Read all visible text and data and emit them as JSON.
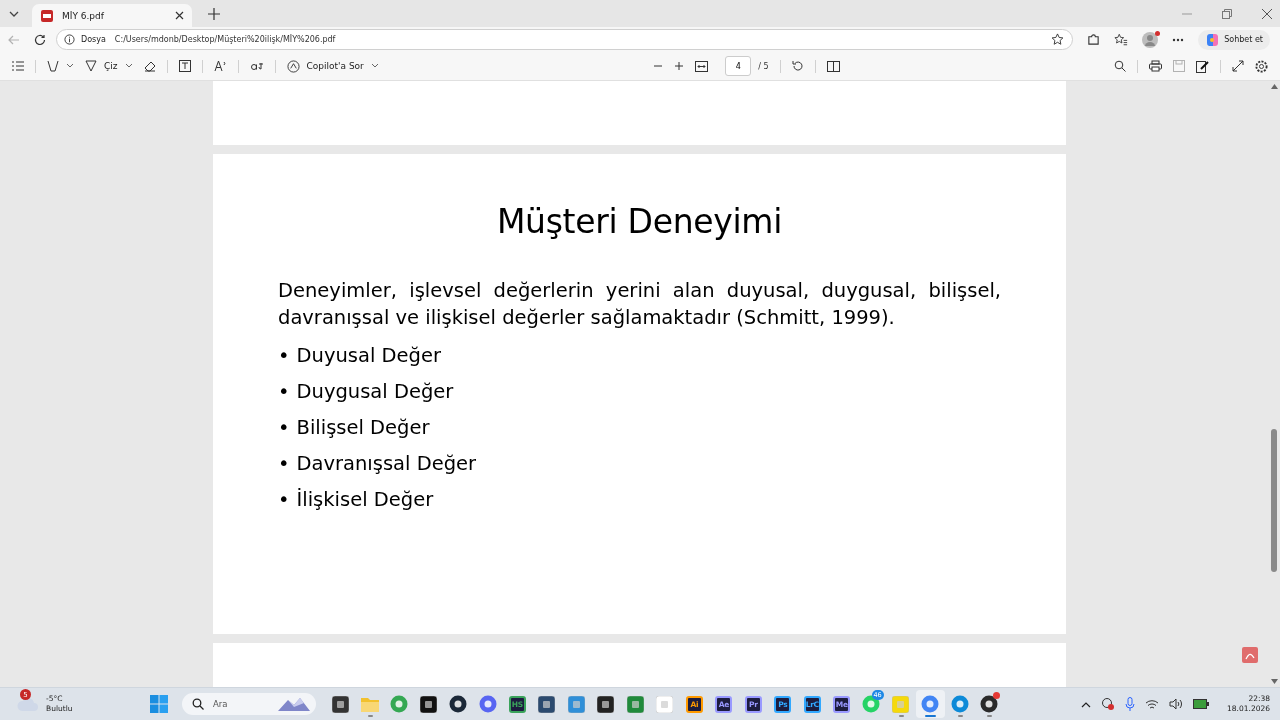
{
  "tabs": [
    {
      "title": "MİY 6.pdf",
      "selected": true
    }
  ],
  "address_bar": {
    "back_disabled": true,
    "scheme_label": "Dosya",
    "url": "C:/Users/mdonb/Desktop/Müşteri%20ilişk/MİY%206.pdf",
    "profile_alert": true,
    "copilot_label": "Sohbet et"
  },
  "pdf_toolbar": {
    "draw_label": "Çiz",
    "ask_label": "Copilot'a Sor",
    "page_value": "4",
    "page_total": "/ 5",
    "save_disabled": true
  },
  "page": {
    "title": "Müşteri Deneyimi",
    "paragraph": "Deneyimler, işlevsel değerlerin yerini alan duyusal, duygusal, bilişsel, davranışsal ve ilişkisel değerler sağlamaktadır (Schmitt, 1999).",
    "bullets": [
      {
        "bullet": "•",
        "text": "Duyusal Değer"
      },
      {
        "bullet": "•",
        "text": "Duygusal Değer"
      },
      {
        "bullet": "•",
        "text": "Bilişsel Değer"
      },
      {
        "bullet": "•",
        "text": "Davranışsal Değer"
      },
      {
        "bullet": "•",
        "text": "İlişkisel Değer"
      }
    ]
  },
  "taskbar": {
    "weather": {
      "badge": "5",
      "temperature": "-5°C",
      "condition": "Bulutlu"
    },
    "search_placeholder": "Ara",
    "apps": [
      {
        "kind": "square",
        "color": "#333333",
        "running": false,
        "active": false,
        "alert": false
      },
      {
        "kind": "folder",
        "color": "#f2c12e",
        "running": true,
        "active": false,
        "alert": false
      },
      {
        "kind": "circle",
        "color": "#34a853",
        "running": false,
        "active": false,
        "alert": false
      },
      {
        "kind": "square",
        "color": "#111111",
        "running": false,
        "active": false,
        "alert": false
      },
      {
        "kind": "circle",
        "color": "#1b2838",
        "running": false,
        "active": false,
        "alert": false
      },
      {
        "kind": "circle",
        "color": "#5865f2",
        "running": false,
        "active": false,
        "alert": false
      },
      {
        "kind": "tile",
        "label": "HS",
        "color": "#3aa35b",
        "running": false,
        "active": false,
        "alert": false
      },
      {
        "kind": "square",
        "color": "#2b4a6f",
        "running": false,
        "active": false,
        "alert": false
      },
      {
        "kind": "square",
        "color": "#2f8fd8",
        "running": false,
        "active": false,
        "alert": false
      },
      {
        "kind": "square",
        "color": "#222222",
        "running": false,
        "active": false,
        "alert": false
      },
      {
        "kind": "square",
        "color": "#1f8a3b",
        "running": false,
        "active": false,
        "alert": false
      },
      {
        "kind": "square",
        "color": "#ffffff",
        "running": false,
        "active": false,
        "alert": false
      },
      {
        "kind": "tile",
        "label": "Ai",
        "color": "#ff9a00",
        "running": false,
        "active": false,
        "alert": false
      },
      {
        "kind": "tile",
        "label": "Ae",
        "color": "#9999ff",
        "running": false,
        "active": false,
        "alert": false
      },
      {
        "kind": "tile",
        "label": "Pr",
        "color": "#9999ff",
        "running": false,
        "active": false,
        "alert": false
      },
      {
        "kind": "tile",
        "label": "Ps",
        "color": "#31a8ff",
        "running": false,
        "active": false,
        "alert": false
      },
      {
        "kind": "tile",
        "label": "LrC",
        "color": "#31a8ff",
        "running": false,
        "active": false,
        "alert": false
      },
      {
        "kind": "tile",
        "label": "Me",
        "color": "#9999ff",
        "running": false,
        "active": false,
        "alert": false
      },
      {
        "kind": "circle",
        "color": "#25d366",
        "badge": "46",
        "running": false,
        "active": false,
        "alert": false
      },
      {
        "kind": "square",
        "color": "#f5d90a",
        "running": true,
        "active": false,
        "alert": false
      },
      {
        "kind": "circle",
        "color": "#4285f4",
        "running": true,
        "active": true,
        "alert": false
      },
      {
        "kind": "circle",
        "color": "#0c8ad8",
        "running": true,
        "active": false,
        "alert": false
      },
      {
        "kind": "circle",
        "color": "#2a2a2a",
        "running": true,
        "active": false,
        "alert": true
      }
    ],
    "time": "22:38",
    "date": "18.01.2026"
  }
}
